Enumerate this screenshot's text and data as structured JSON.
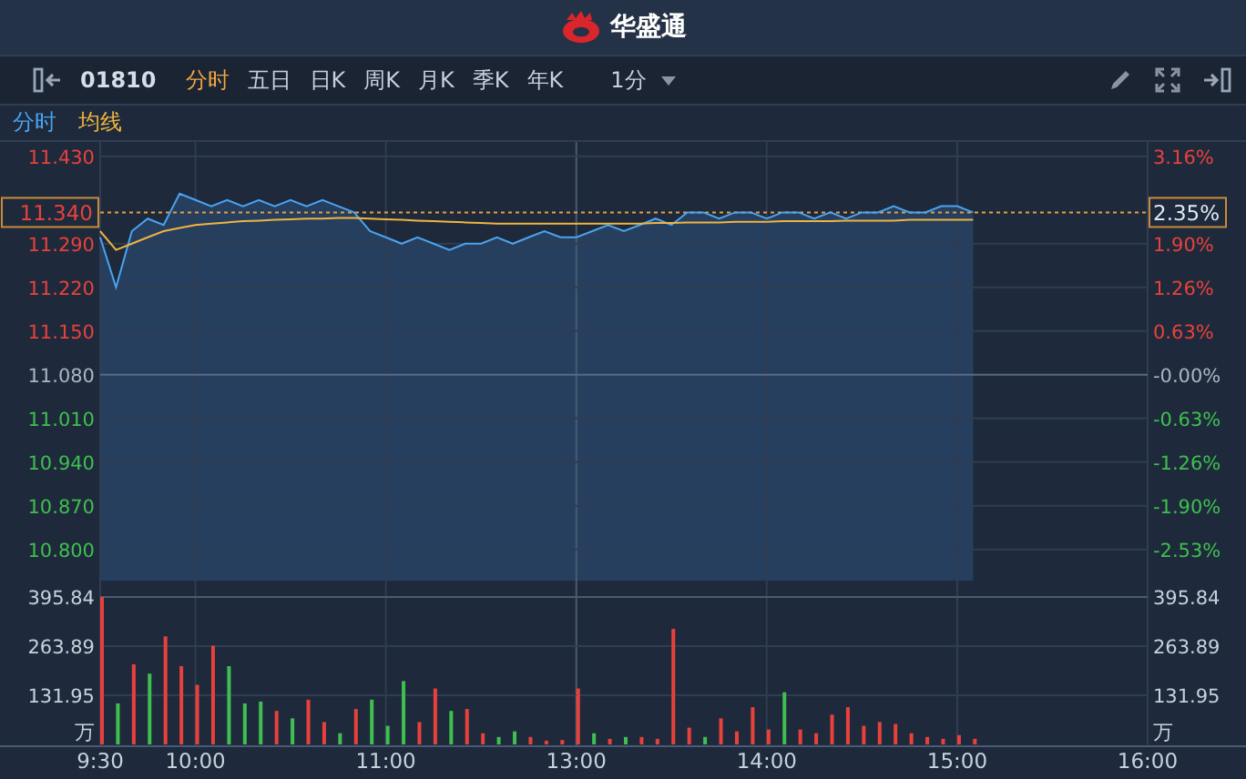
{
  "header": {
    "brand": "华盛通"
  },
  "toolbar": {
    "code": "01810",
    "tabs": [
      {
        "label": "分时",
        "selected": true
      },
      {
        "label": "五日",
        "selected": false
      },
      {
        "label": "日K",
        "selected": false
      },
      {
        "label": "周K",
        "selected": false
      },
      {
        "label": "月K",
        "selected": false
      },
      {
        "label": "季K",
        "selected": false
      },
      {
        "label": "年K",
        "selected": false
      }
    ],
    "interval": "1分"
  },
  "price_panel": {
    "cursor": {
      "price": "11.340",
      "percent": "2.35%"
    },
    "right_axis": [
      {
        "label": "3.16%",
        "color": "#e8413c"
      },
      {
        "label": "1.90%",
        "color": "#e8413c"
      },
      {
        "label": "1.26%",
        "color": "#e8413c"
      },
      {
        "label": "0.63%",
        "color": "#e8413c"
      },
      {
        "label": "-0.00%",
        "color": "#aab4c4"
      },
      {
        "label": "-0.63%",
        "color": "#3fbf4f"
      },
      {
        "label": "-1.26%",
        "color": "#3fbf4f"
      },
      {
        "label": "-1.90%",
        "color": "#3fbf4f"
      },
      {
        "label": "-2.53%",
        "color": "#3fbf4f"
      }
    ],
    "chart_data": {
      "type": "line",
      "grid": true,
      "ylim": [
        10.75,
        11.45
      ],
      "ref_lines": [
        {
          "axis": "y",
          "value": 11.08,
          "color": "#5a6a82"
        },
        {
          "axis": "y",
          "value": 11.34,
          "color": "#e8a040"
        }
      ],
      "yticks": [
        {
          "value": 11.43,
          "label": "11.430"
        },
        {
          "value": 11.29,
          "label": "11.290"
        },
        {
          "value": 11.22,
          "label": "11.220"
        },
        {
          "value": 11.15,
          "label": "11.150"
        },
        {
          "value": 11.08,
          "label": "11.080"
        },
        {
          "value": 11.01,
          "label": "11.010"
        },
        {
          "value": 10.94,
          "label": "10.940"
        },
        {
          "value": 10.87,
          "label": "10.870"
        },
        {
          "value": 10.8,
          "label": "10.800"
        }
      ],
      "series": [
        {
          "name": "分时",
          "type": "area",
          "color": "#4aa3f0",
          "values": [
            11.3,
            11.22,
            11.31,
            11.33,
            11.32,
            11.37,
            11.36,
            11.35,
            11.36,
            11.35,
            11.36,
            11.35,
            11.36,
            11.35,
            11.36,
            11.35,
            11.34,
            11.31,
            11.3,
            11.29,
            11.3,
            11.29,
            11.28,
            11.29,
            11.29,
            11.3,
            11.29,
            11.3,
            11.31,
            11.3,
            11.3,
            11.31,
            11.32,
            11.31,
            11.32,
            11.33,
            11.32,
            11.34,
            11.34,
            11.33,
            11.34,
            11.34,
            11.33,
            11.34,
            11.34,
            11.33,
            11.34,
            11.33,
            11.34,
            11.34,
            11.35,
            11.34,
            11.34,
            11.35,
            11.35,
            11.34
          ]
        },
        {
          "name": "均线",
          "type": "line",
          "color": "#f0b540",
          "values": [
            11.31,
            11.28,
            11.29,
            11.3,
            11.31,
            11.315,
            11.32,
            11.322,
            11.324,
            11.326,
            11.327,
            11.328,
            11.329,
            11.33,
            11.33,
            11.331,
            11.331,
            11.33,
            11.329,
            11.328,
            11.327,
            11.326,
            11.325,
            11.324,
            11.323,
            11.322,
            11.322,
            11.322,
            11.322,
            11.322,
            11.322,
            11.322,
            11.322,
            11.322,
            11.322,
            11.323,
            11.323,
            11.324,
            11.324,
            11.324,
            11.325,
            11.325,
            11.325,
            11.326,
            11.326,
            11.326,
            11.326,
            11.327,
            11.327,
            11.327,
            11.327,
            11.328,
            11.328,
            11.328,
            11.328,
            11.328
          ]
        }
      ]
    }
  },
  "volume_panel": {
    "unit_left": "万",
    "unit_right": "万",
    "chart_data": {
      "type": "bar",
      "stacked": true,
      "grid": true,
      "ylim": [
        0,
        425
      ],
      "yticks": [
        {
          "value": 395.84,
          "label": "395.84"
        },
        {
          "value": 263.89,
          "label": "263.89"
        },
        {
          "value": 131.95,
          "label": "131.95"
        }
      ],
      "categories": [
        "9:30",
        null,
        null,
        null,
        null,
        null,
        "10:00",
        null,
        null,
        null,
        null,
        null,
        null,
        null,
        null,
        null,
        null,
        null,
        "11:00",
        null,
        null,
        null,
        null,
        null,
        null,
        null,
        null,
        null,
        null,
        null,
        "13:00",
        null,
        null,
        null,
        null,
        null,
        null,
        null,
        null,
        null,
        null,
        null,
        "14:00",
        null,
        null,
        null,
        null,
        null,
        null,
        null,
        null,
        null,
        null,
        null,
        "15:00",
        null,
        null,
        null,
        null,
        null,
        null,
        null,
        null,
        null,
        null,
        null,
        "16:00"
      ],
      "series": [
        {
          "color": "#e8413c",
          "values": [
            396,
            null,
            215,
            null,
            290,
            210,
            160,
            265,
            null,
            null,
            null,
            90,
            null,
            120,
            60,
            null,
            95,
            null,
            null,
            null,
            60,
            150,
            null,
            95,
            30,
            null,
            null,
            20,
            10,
            12,
            150,
            null,
            15,
            null,
            20,
            15,
            310,
            45,
            null,
            70,
            35,
            100,
            40,
            null,
            40,
            30,
            80,
            100,
            50,
            60,
            55,
            30,
            20,
            15,
            25,
            15,
            null,
            null,
            null,
            null,
            null,
            null,
            null,
            null,
            null,
            null,
            null
          ]
        },
        {
          "color": "#3fbf4f",
          "values": [
            null,
            110,
            null,
            190,
            null,
            null,
            null,
            null,
            210,
            110,
            115,
            null,
            70,
            null,
            null,
            30,
            null,
            120,
            50,
            170,
            null,
            null,
            90,
            null,
            null,
            20,
            35,
            null,
            null,
            null,
            null,
            30,
            null,
            20,
            null,
            null,
            null,
            null,
            20,
            null,
            null,
            null,
            null,
            140,
            null,
            null,
            null,
            null,
            null,
            null,
            null,
            null,
            null,
            null,
            null,
            null,
            null,
            null,
            null,
            null,
            null,
            null,
            null,
            null,
            null,
            null,
            null
          ]
        }
      ]
    }
  }
}
